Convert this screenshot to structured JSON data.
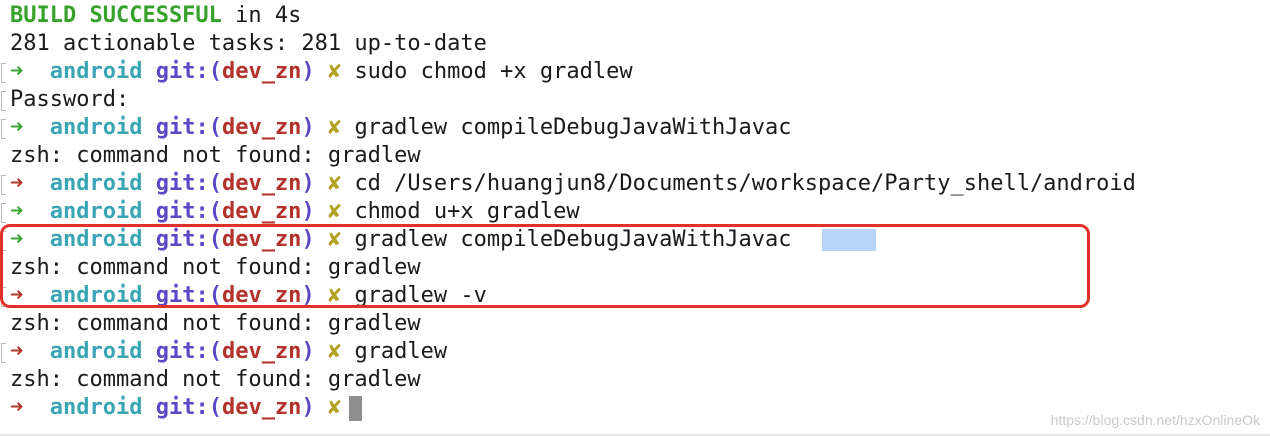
{
  "header": {
    "build_status_bold": "BUILD SUCCESSFUL",
    "build_time": " in 4s",
    "tasks_line": "281 actionable tasks: 281 up-to-date"
  },
  "prompt": {
    "arrow": "➜",
    "dir": "android",
    "git_label": "git:(",
    "branch": "dev_zn",
    "git_close": ")",
    "dirty_mark": "✘"
  },
  "lines": {
    "cmd1": "sudo chmod +x gradlew",
    "password": "Password:",
    "cmd2": "gradlew compileDebugJavaWithJavac",
    "err1": "zsh: command not found: gradlew",
    "cmd3": "cd /Users/huangjun8/Documents/workspace/Party_shell/android",
    "cmd4": "chmod u+x gradlew",
    "cmd5": "gradlew compileDebugJavaWithJavac",
    "err2": "zsh: command not found: gradlew",
    "cmd6": "gradlew -v",
    "err3": "zsh: command not found: gradlew",
    "cmd7": "gradlew",
    "err4": "zsh: command not found: gradlew"
  },
  "watermark": "https://blog.csdn.net/hzxOnlineOk",
  "colors": {
    "success": "#37a22b",
    "arrow_ok": "#3aa433",
    "arrow_fail": "#b03a2e",
    "dir": "#3aa5b4",
    "git": "#5a48c8",
    "branch": "#b3322b",
    "dirty": "#b3a227",
    "highlight_border": "#e0322a"
  }
}
